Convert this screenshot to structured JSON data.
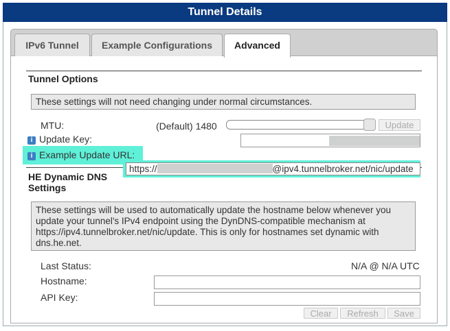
{
  "header": {
    "title": "Tunnel Details"
  },
  "tabs": [
    {
      "label": "IPv6 Tunnel"
    },
    {
      "label": "Example Configurations"
    },
    {
      "label": "Advanced"
    }
  ],
  "tunnel_options": {
    "title": "Tunnel Options",
    "notice": "These settings will not need changing under normal circumstances.",
    "mtu_label": "MTU:",
    "mtu_value": "(Default) 1480",
    "mtu_update_button": "Update",
    "update_key_label": "Update Key:",
    "example_url_label": "Example Update URL:",
    "example_url_prefix": "https://",
    "example_url_suffix": "@ipv4.tunnelbroker.net/nic/update"
  },
  "he_dns": {
    "title_line1": "HE Dynamic DNS",
    "title_line2": "Settings",
    "notice": "These settings will be used to automatically update the hostname below whenever you update your tunnel's IPv4 endpoint using the DynDNS-compatible mechanism at https://ipv4.tunnelbroker.net/nic/update. This is only for hostnames set dynamic with dns.he.net.",
    "last_status_label": "Last Status:",
    "last_status_value": "N/A @ N/A UTC",
    "hostname_label": "Hostname:",
    "api_key_label": "API Key:",
    "clear_button": "Clear",
    "refresh_button": "Refresh",
    "save_button": "Save"
  },
  "colors": {
    "header_bg": "#0a3a80",
    "highlight": "#5ff0d8",
    "info_icon": "#3c7fc4"
  },
  "icons": {
    "info": "info-icon"
  }
}
